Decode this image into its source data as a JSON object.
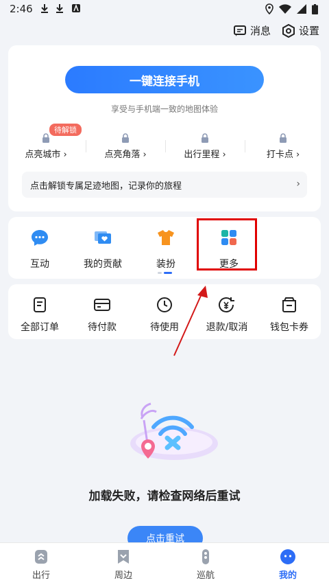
{
  "status_bar": {
    "time": "2:46"
  },
  "header": {
    "messages_label": "消息",
    "settings_label": "设置"
  },
  "map_card": {
    "connect_button": "一键连接手机",
    "subtitle": "享受与手机端一致的地图体验",
    "badge": "待解锁",
    "stats": [
      {
        "label": "点亮城市 ›"
      },
      {
        "label": "点亮角落 ›"
      },
      {
        "label": "出行里程 ›"
      },
      {
        "label": "打卡点 ›"
      }
    ],
    "unlock_text": "点击解锁专属足迹地图，记录你的旅程",
    "unlock_chevron": "›"
  },
  "services": [
    {
      "label": "互动",
      "icon": "chat-bubble-icon",
      "color": "#2f8cf2"
    },
    {
      "label": "我的贡献",
      "icon": "heart-message-icon",
      "color": "#2f8cf2"
    },
    {
      "label": "装扮",
      "icon": "tshirt-icon",
      "color": "#f7931e"
    },
    {
      "label": "更多",
      "icon": "grid-more-icon",
      "color": "#33b3e8"
    }
  ],
  "orders": [
    {
      "label": "全部订单",
      "icon": "order-list-icon"
    },
    {
      "label": "待付款",
      "icon": "card-icon"
    },
    {
      "label": "待使用",
      "icon": "clock-icon"
    },
    {
      "label": "退款/取消",
      "icon": "refund-icon"
    },
    {
      "label": "钱包卡券",
      "icon": "wallet-icon"
    }
  ],
  "empty_state": {
    "message": "加载失败，请检查网络后重试",
    "retry_button": "点击重试"
  },
  "bottom_nav": [
    {
      "label": "出行",
      "icon": "travel-icon",
      "active": false
    },
    {
      "label": "周边",
      "icon": "nearby-icon",
      "active": false
    },
    {
      "label": "巡航",
      "icon": "cruise-icon",
      "active": false
    },
    {
      "label": "我的",
      "icon": "profile-icon",
      "active": true
    }
  ],
  "colors": {
    "accent": "#2d6df6",
    "badge": "#f36b5e",
    "highlight": "#e00000"
  }
}
